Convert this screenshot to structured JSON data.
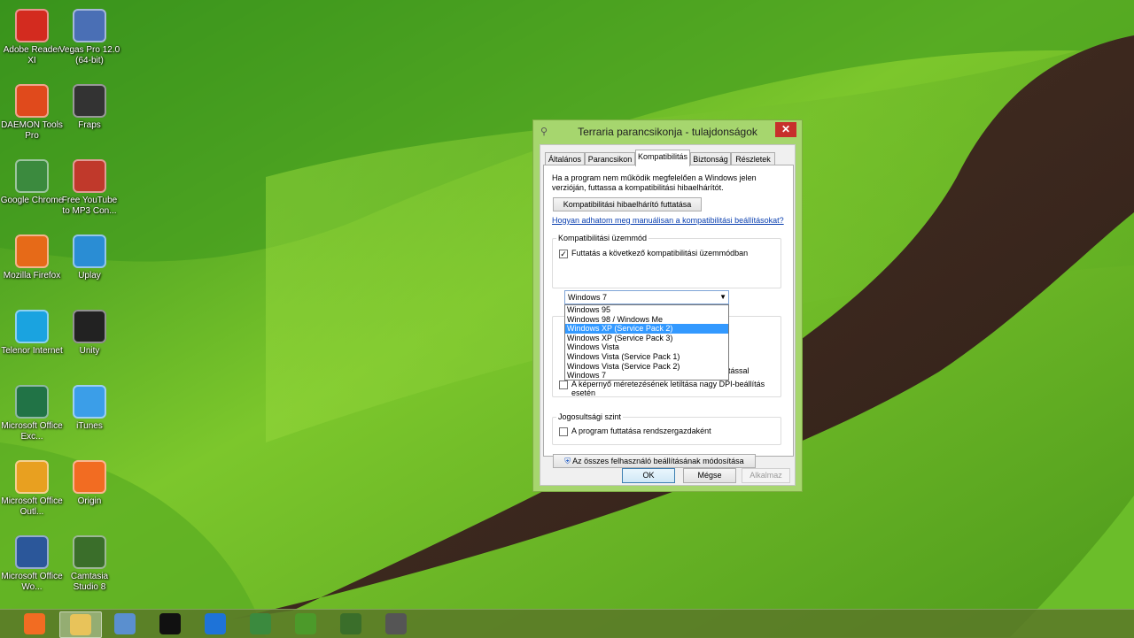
{
  "desktop_icons": [
    {
      "label": "Adobe Reader XI",
      "icon": "adobe-reader-icon",
      "color": "#d32b1f"
    },
    {
      "label": "Vegas Pro 12.0 (64-bit)",
      "icon": "vegas-pro-icon",
      "color": "#4a6fb5"
    },
    {
      "label": "DAEMON Tools Pro",
      "icon": "daemon-tools-icon",
      "color": "#e04a1c"
    },
    {
      "label": "Fraps",
      "icon": "fraps-icon",
      "color": "#333333"
    },
    {
      "label": "Google Chrome",
      "icon": "chrome-icon",
      "color": "#3b8a3e"
    },
    {
      "label": "Free YouTube to MP3 Con...",
      "icon": "youtube-mp3-icon",
      "color": "#c0392b"
    },
    {
      "label": "Mozilla Firefox",
      "icon": "firefox-icon",
      "color": "#e66a18"
    },
    {
      "label": "Uplay",
      "icon": "uplay-icon",
      "color": "#2a8dd4"
    },
    {
      "label": "Telenor Internet",
      "icon": "telenor-icon",
      "color": "#1aa3e0"
    },
    {
      "label": "Unity",
      "icon": "unity-icon",
      "color": "#222222"
    },
    {
      "label": "Microsoft Office Exc...",
      "icon": "excel-icon",
      "color": "#217346"
    },
    {
      "label": "iTunes",
      "icon": "itunes-icon",
      "color": "#3b9ee8"
    },
    {
      "label": "Microsoft Office Outl...",
      "icon": "outlook-icon",
      "color": "#e8a020"
    },
    {
      "label": "Origin",
      "icon": "origin-icon",
      "color": "#f26c22"
    },
    {
      "label": "Microsoft Office Wo...",
      "icon": "word-icon",
      "color": "#2b579a"
    },
    {
      "label": "Camtasia Studio 8",
      "icon": "camtasia-icon",
      "color": "#3a6e2a"
    }
  ],
  "taskbar": [
    {
      "icon": "origin-taskbar-icon",
      "color": "#f26c22"
    },
    {
      "icon": "file-explorer-icon",
      "color": "#e8c35a",
      "active": true
    },
    {
      "icon": "window-icon",
      "color": "#5a8fcf"
    },
    {
      "icon": "cmd-icon",
      "color": "#111111"
    },
    {
      "icon": "internet-explorer-icon",
      "color": "#1e73d8"
    },
    {
      "icon": "chrome-taskbar-icon",
      "color": "#3b8a3e"
    },
    {
      "icon": "utorrent-icon",
      "color": "#4c9a2a"
    },
    {
      "icon": "camtasia-taskbar-icon",
      "color": "#3a6e2a"
    },
    {
      "icon": "camtasia-recorder-icon",
      "color": "#555555"
    }
  ],
  "dialog": {
    "title": "Terraria parancsikonja - tulajdonságok",
    "close": "✕",
    "tabs": [
      "Általános",
      "Parancsikon",
      "Kompatibilitás",
      "Biztonság",
      "Részletek"
    ],
    "active_tab": "Kompatibilitás",
    "intro_line1": "Ha a program nem működik megfelelően a Windows jelen",
    "intro_line2": "verzióján, futtassa a kompatibilitási hibaelhárítót.",
    "troubleshooter_button": "Kompatibilitási hibaelhárító futtatása",
    "manual_link": "Hogyan adhatom meg manuálisan a kompatibilitási beállításokat?",
    "compat_group_label": "Kompatibilitási üzemmód",
    "compat_checkbox_label": "Futtatás a következő kompatibilitási üzemmódban",
    "compat_checked": true,
    "compat_selected": "Windows 7",
    "compat_options": [
      "Windows 95",
      "Windows 98 / Windows Me",
      "Windows XP (Service Pack 2)",
      "Windows XP (Service Pack 3)",
      "Windows Vista",
      "Windows Vista (Service Pack 1)",
      "Windows Vista (Service Pack 2)",
      "Windows 7"
    ],
    "highlighted_option": "Windows XP (Service Pack 2)",
    "hidden_partial_text": "ntással",
    "dpi_checkbox_line1": "A képernyő méretezésének letiltása nagy DPI-beállítás",
    "dpi_checkbox_line2": "esetén",
    "privilege_group_label": "Jogosultsági szint",
    "admin_checkbox_label": "A program futtatása rendszergazdaként",
    "all_users_button": "Az összes felhasználó beállításának módosítása",
    "ok": "OK",
    "cancel": "Mégse",
    "apply": "Alkalmaz"
  }
}
